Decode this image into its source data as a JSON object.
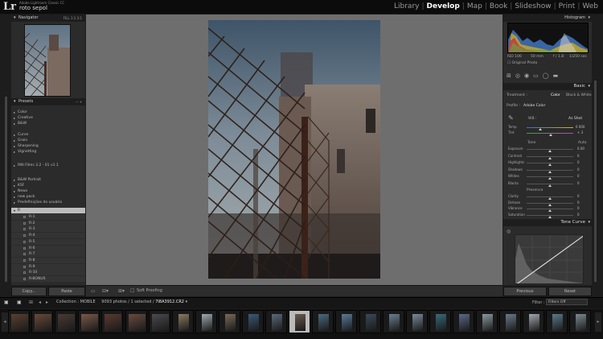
{
  "app": {
    "logo": "Lr",
    "subtitle": "Adobe Lightroom Classic CC",
    "catalog": "roto sepol"
  },
  "modules": [
    "Library",
    "Develop",
    "Map",
    "Book",
    "Slideshow",
    "Print",
    "Web"
  ],
  "active_module": "Develop",
  "navigator": {
    "title": "Navigator",
    "zoom_options": "FILL  1:1  3:1"
  },
  "presets": {
    "title": "Presets",
    "groups": [
      {
        "label": "Color",
        "tri": "▸"
      },
      {
        "label": "Creative",
        "tri": "▸"
      },
      {
        "label": "B&W",
        "tri": "▸"
      },
      {
        "label": "Curve",
        "tri": "▸"
      },
      {
        "label": "Grain",
        "tri": "▸"
      },
      {
        "label": "Sharpening",
        "tri": "▸"
      },
      {
        "label": "Vignetting",
        "tri": "▸"
      },
      {
        "label": "RNI Films 3.2 - 01 v1.1",
        "tri": "▸"
      },
      {
        "label": "B&W Portrait",
        "tri": "▸"
      },
      {
        "label": "KSF",
        "tri": "▸"
      },
      {
        "label": "News",
        "tri": "▸"
      },
      {
        "label": "new pack",
        "tri": "▸"
      },
      {
        "label": "Predefinições do usuário",
        "tri": "▸"
      },
      {
        "label": "R",
        "tri": "▾"
      }
    ],
    "sub_items": [
      "R-1",
      "R-2",
      "R-3",
      "R-4",
      "R-5",
      "R-6",
      "R-7",
      "R-8",
      "R-9",
      "R-10",
      "R-BONUS"
    ]
  },
  "left_buttons": {
    "copy": "Copy...",
    "paste": "Paste"
  },
  "toolbar": {
    "soft_proofing": "Soft Proofing"
  },
  "histogram": {
    "title": "Histogram",
    "iso": "ISO 100",
    "focal": "50 mm",
    "aperture": "f / 1.8",
    "shutter": "1/250 sec",
    "original_photo": "Original Photo"
  },
  "basic": {
    "title": "Basic",
    "treatment_label": "Treatment :",
    "treatment_color": "Color",
    "treatment_bw": "Black & White",
    "profile_label": "Profile :",
    "profile_value": "Adobe Color",
    "wb_label": "WB :",
    "wb_value": "As Shot",
    "temp_label": "Temp",
    "temp_value": "6 600",
    "tint_label": "Tint",
    "tint_value": "+ 3",
    "tone_label": "Tone",
    "tone_auto": "Auto",
    "sliders": [
      {
        "label": "Exposure",
        "value": "0.00",
        "pos": 0.5
      },
      {
        "label": "Contrast",
        "value": "0",
        "pos": 0.5
      },
      {
        "label": "Highlights",
        "value": "0",
        "pos": 0.5
      },
      {
        "label": "Shadows",
        "value": "0",
        "pos": 0.5
      },
      {
        "label": "Whites",
        "value": "0",
        "pos": 0.5
      },
      {
        "label": "Blacks",
        "value": "0",
        "pos": 0.5
      }
    ],
    "presence_label": "Presence",
    "presence_sliders": [
      {
        "label": "Clarity",
        "value": "0",
        "pos": 0.5
      },
      {
        "label": "Dehaze",
        "value": "0",
        "pos": 0.5
      },
      {
        "label": "Vibrance",
        "value": "0",
        "pos": 0.5
      },
      {
        "label": "Saturation",
        "value": "0",
        "pos": 0.5
      }
    ]
  },
  "tone_curve": {
    "title": "Tone Curve"
  },
  "right_buttons": {
    "previous": "Previous",
    "reset": "Reset"
  },
  "filmstrip": {
    "collection": "Collection : MOBILE",
    "count": "9093 photos / 1 selected /",
    "filename": "7I8A3912.CR2",
    "filter_label": "Filter :",
    "filter_value": "Filters Off"
  },
  "colors": {
    "accent": "#ffffff",
    "panel": "#2b2b2b",
    "selected": "#bdbdbd"
  }
}
